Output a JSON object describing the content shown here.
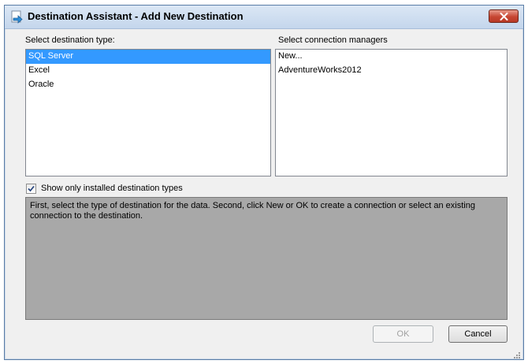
{
  "window": {
    "title": "Destination Assistant - Add New Destination"
  },
  "destination_type": {
    "label": "Select destination type:",
    "items": [
      "SQL Server",
      "Excel",
      "Oracle"
    ],
    "selected": "SQL Server"
  },
  "connection_managers": {
    "label": "Select connection managers",
    "items": [
      "New...",
      "AdventureWorks2012"
    ]
  },
  "show_installed": {
    "label": "Show only installed destination types",
    "checked": true
  },
  "info": {
    "text": "First, select the type of destination for the data. Second, click New or OK to create a connection or select an existing connection to the destination."
  },
  "buttons": {
    "ok_label": "OK",
    "cancel_label": "Cancel"
  },
  "colors": {
    "selection": "#3399ff",
    "info_panel": "#a8a8a8",
    "close_button": "#c74633"
  },
  "icons": {
    "title": "destination-wizard-icon",
    "close": "close-icon",
    "check": "checkmark-icon",
    "grip": "resize-grip-icon"
  }
}
